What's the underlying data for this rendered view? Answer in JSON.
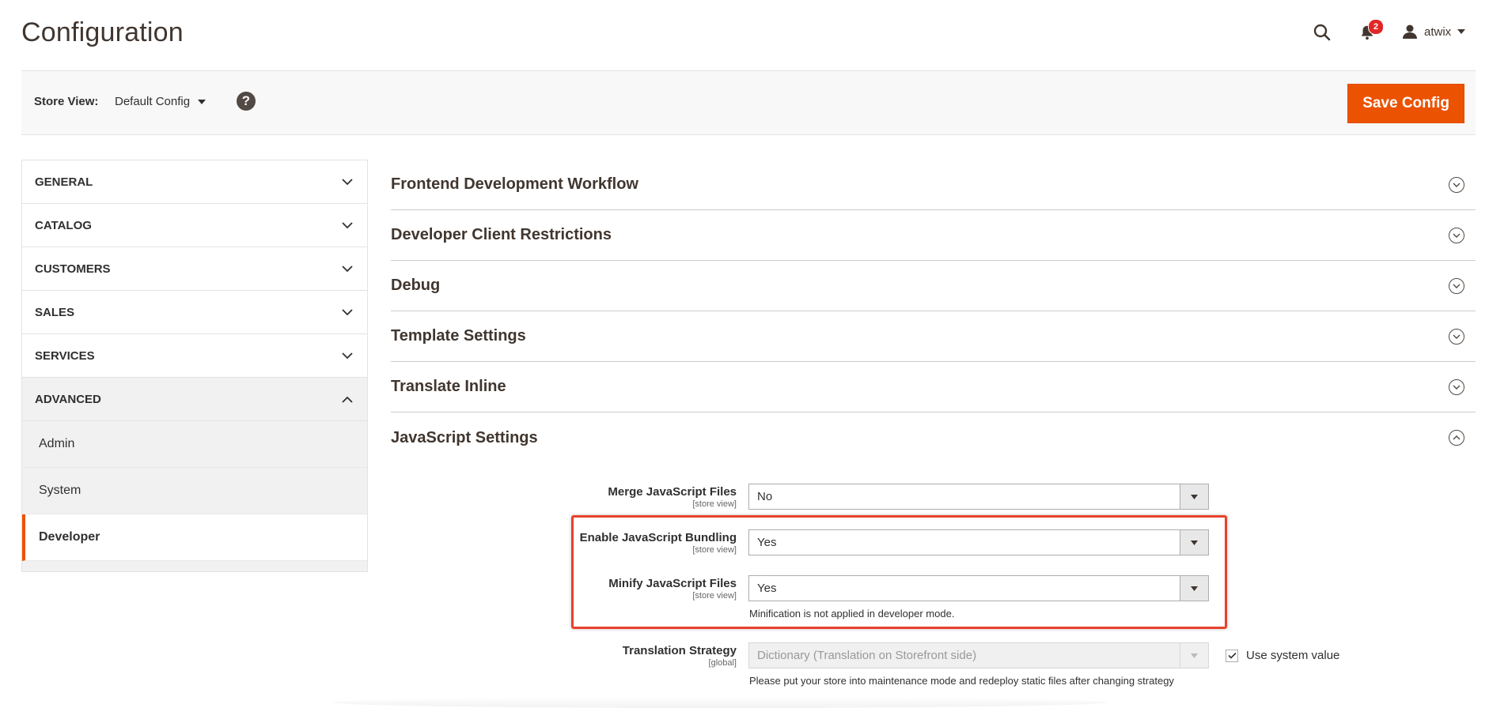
{
  "page": {
    "title": "Configuration"
  },
  "header": {
    "notifications_count": "2",
    "username": "atwix"
  },
  "store_view": {
    "label": "Store View:",
    "selected": "Default Config",
    "help": "?",
    "save_label": "Save Config"
  },
  "sidebar": {
    "tabs": [
      {
        "label": "GENERAL"
      },
      {
        "label": "CATALOG"
      },
      {
        "label": "CUSTOMERS"
      },
      {
        "label": "SALES"
      },
      {
        "label": "SERVICES"
      },
      {
        "label": "ADVANCED"
      }
    ],
    "advanced_items": [
      {
        "label": "Admin"
      },
      {
        "label": "System"
      },
      {
        "label": "Developer"
      }
    ]
  },
  "sections": [
    {
      "title": "Frontend Development Workflow"
    },
    {
      "title": "Developer Client Restrictions"
    },
    {
      "title": "Debug"
    },
    {
      "title": "Template Settings"
    },
    {
      "title": "Translate Inline"
    },
    {
      "title": "JavaScript Settings"
    }
  ],
  "js_settings": {
    "merge": {
      "label": "Merge JavaScript Files",
      "scope": "[store view]",
      "value": "No"
    },
    "bundling": {
      "label": "Enable JavaScript Bundling",
      "scope": "[store view]",
      "value": "Yes"
    },
    "minify": {
      "label": "Minify JavaScript Files",
      "scope": "[store view]",
      "value": "Yes",
      "note": "Minification is not applied in developer mode."
    },
    "translation": {
      "label": "Translation Strategy",
      "scope": "[global]",
      "value": "Dictionary (Translation on Storefront side)",
      "use_system": "Use system value",
      "note": "Please put your store into maintenance mode and redeploy static files after changing strategy"
    }
  },
  "colors": {
    "accent": "#eb5202",
    "highlight": "#e8412c",
    "badge": "#e22626"
  }
}
